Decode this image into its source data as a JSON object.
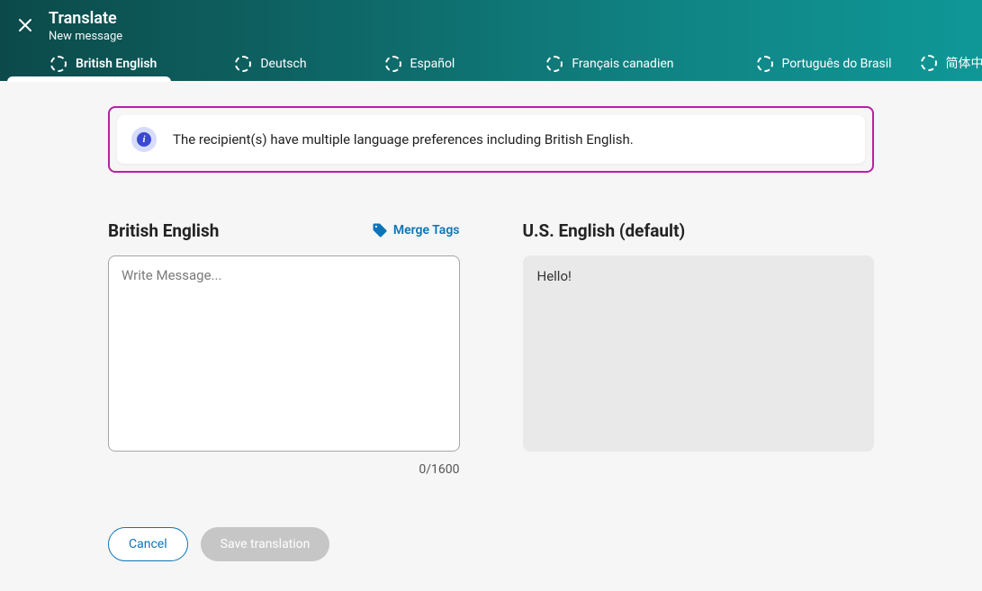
{
  "header": {
    "title": "Translate",
    "subtitle": "New message"
  },
  "tabs": [
    {
      "label": "British English",
      "active": true
    },
    {
      "label": "Deutsch",
      "active": false
    },
    {
      "label": "Español",
      "active": false
    },
    {
      "label": "Français canadien",
      "active": false
    },
    {
      "label": "Português do Brasil",
      "active": false
    },
    {
      "label": "简体中文",
      "active": false
    }
  ],
  "info": {
    "text": "The recipient(s) have multiple language preferences including British English."
  },
  "editor": {
    "title": "British English",
    "merge_tags_label": "Merge Tags",
    "placeholder": "Write Message...",
    "value": "",
    "char_count": "0/1600"
  },
  "default_panel": {
    "title": "U.S. English (default)",
    "content": "Hello!"
  },
  "actions": {
    "cancel": "Cancel",
    "save": "Save translation"
  }
}
